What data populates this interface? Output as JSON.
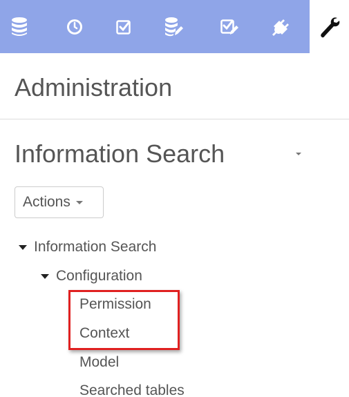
{
  "toolbar": {
    "items": [
      {
        "icon": "database-icon"
      },
      {
        "icon": "clock-icon"
      },
      {
        "icon": "checkbox-icon"
      },
      {
        "icon": "database-edit-icon"
      },
      {
        "icon": "checkbox-edit-icon"
      },
      {
        "icon": "plug-icon"
      },
      {
        "icon": "wrench-icon",
        "active": true
      }
    ],
    "strip_color": "#8fa5e8"
  },
  "page": {
    "title": "Administration",
    "section_title": "Information Search"
  },
  "actions": {
    "label": "Actions"
  },
  "tree": {
    "root": "Information Search",
    "configuration": "Configuration",
    "items": [
      "Permission",
      "Context",
      "Model",
      "Searched tables"
    ]
  },
  "highlight": {
    "color": "#e02020"
  }
}
